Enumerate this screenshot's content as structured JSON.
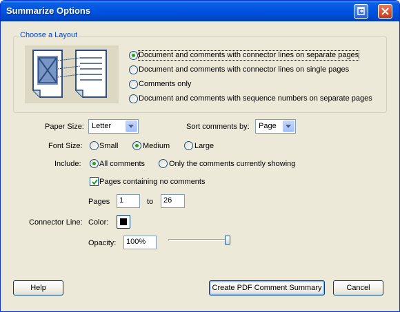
{
  "window": {
    "title": "Summarize Options"
  },
  "layout_group": {
    "legend": "Choose a Layout",
    "options": [
      {
        "label": "Document and comments with connector lines on separate pages",
        "checked": true
      },
      {
        "label": "Document and comments with connector lines on single pages",
        "checked": false
      },
      {
        "label": "Comments only",
        "checked": false
      },
      {
        "label": "Document and comments with sequence numbers on separate pages",
        "checked": false
      }
    ]
  },
  "paper_size": {
    "label": "Paper Size:",
    "value": "Letter"
  },
  "sort": {
    "label": "Sort comments by:",
    "value": "Page"
  },
  "font_size": {
    "label": "Font Size:",
    "options": [
      "Small",
      "Medium",
      "Large"
    ],
    "selected": "Medium"
  },
  "include": {
    "label": "Include:",
    "all": "All comments",
    "showing": "Only the comments currently showing",
    "selected": "All comments"
  },
  "no_comments_pages": {
    "label": "Pages containing no comments",
    "checked": true
  },
  "pages": {
    "label": "Pages",
    "from": "1",
    "to_label": "to",
    "to": "26"
  },
  "connector": {
    "label": "Connector Line:",
    "color_label": "Color:",
    "color": "#000000",
    "opacity_label": "Opacity:",
    "opacity": "100%",
    "opacity_value": 1.0
  },
  "buttons": {
    "help": "Help",
    "create": "Create PDF Comment Summary",
    "cancel": "Cancel"
  }
}
